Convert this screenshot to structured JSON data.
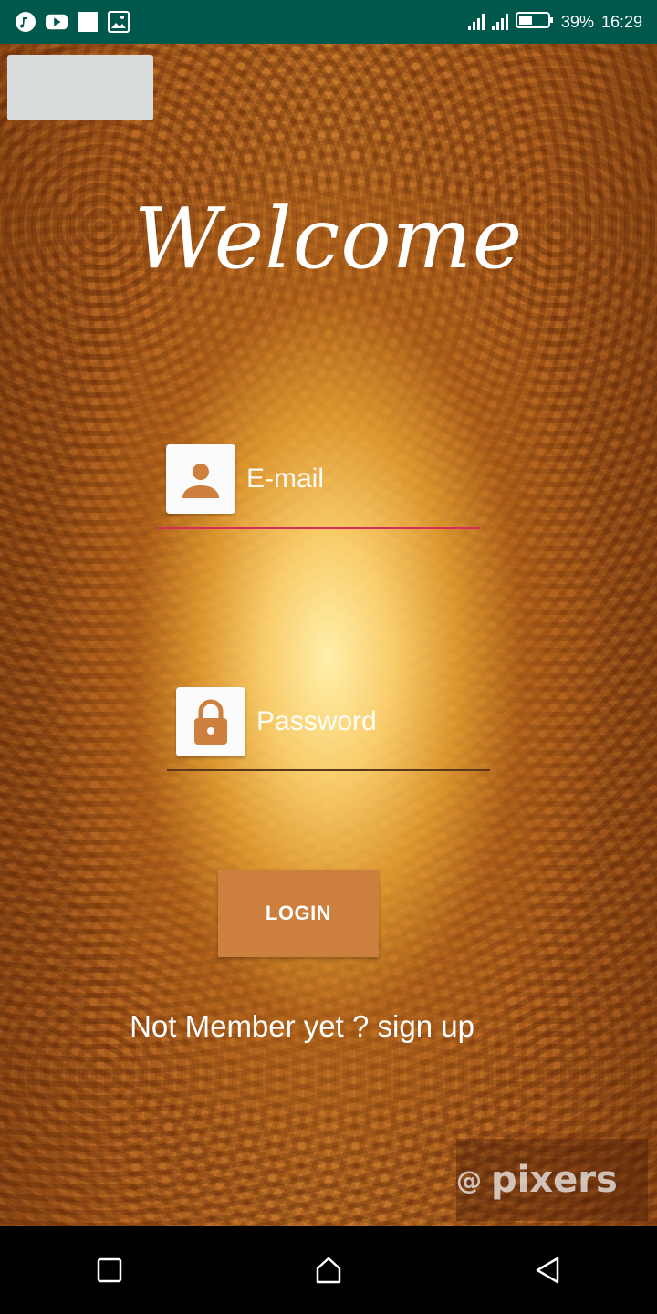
{
  "status_bar": {
    "battery": "39%",
    "time": "16:29",
    "left_icons": [
      "music-icon",
      "youtube-icon",
      "square-icon",
      "image-icon"
    ],
    "right_icons": [
      "signal-icon",
      "signal-icon",
      "battery-icon"
    ]
  },
  "title": "Welcome",
  "email": {
    "placeholder": "E-mail",
    "icon": "person-icon",
    "underline_color": "#d32f5a"
  },
  "password": {
    "placeholder": "Password",
    "icon": "lock-icon",
    "underline_color": "#5a3a1a"
  },
  "login_button": {
    "label": "LOGIN"
  },
  "signup_text": "Not Member yet ? sign up",
  "watermark": "pixers",
  "nav": {
    "icons": [
      "recents-icon",
      "home-icon",
      "back-icon"
    ]
  },
  "colors": {
    "status_bar": "#00574b",
    "accent": "#cd7f3e"
  }
}
